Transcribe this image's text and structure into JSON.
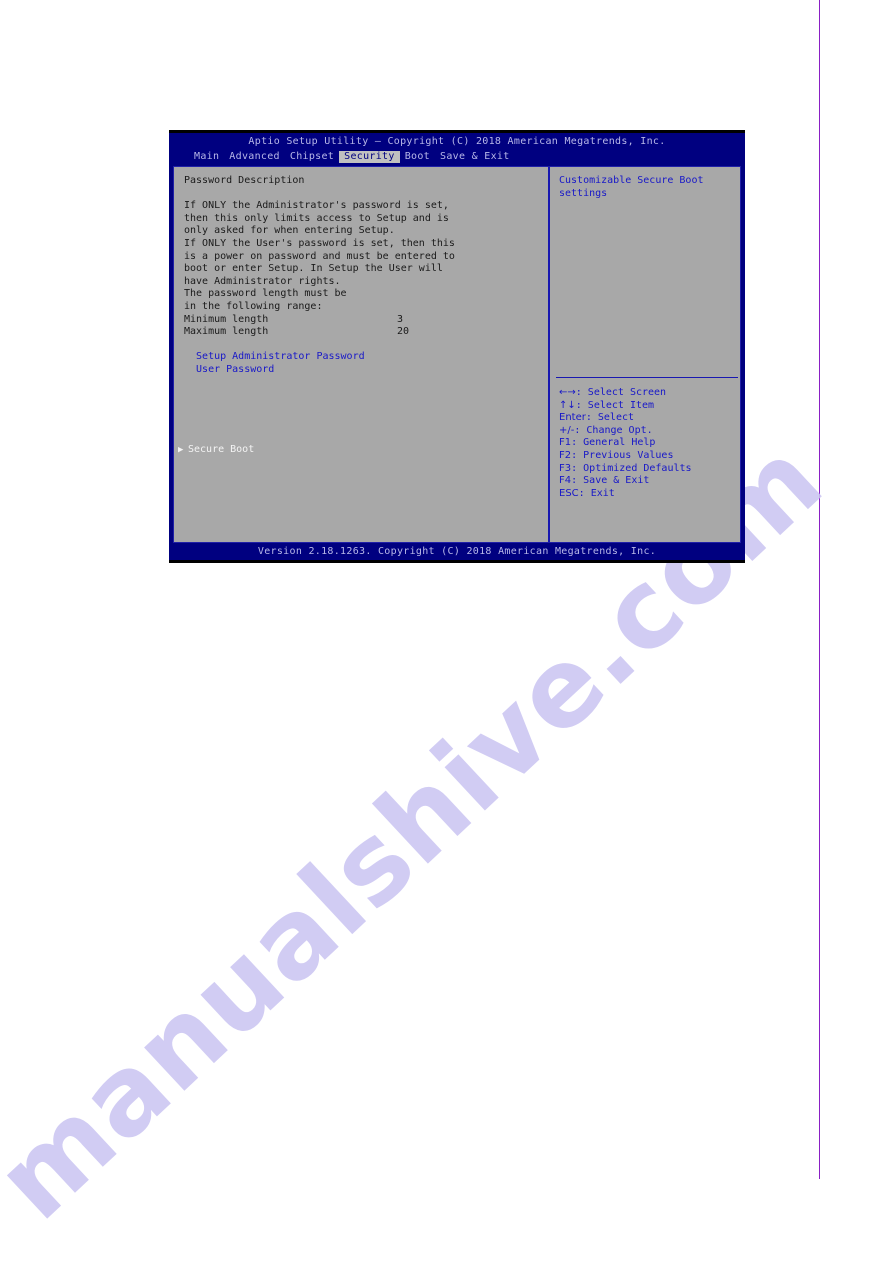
{
  "page": {
    "watermark_text": "manualshive.com",
    "margin_line_color": "#8a1fc4"
  },
  "bios": {
    "title": "Aptio Setup Utility – Copyright (C) 2018 American Megatrends, Inc.",
    "menu": [
      {
        "label": "Main",
        "active": false
      },
      {
        "label": "Advanced",
        "active": false
      },
      {
        "label": "Chipset",
        "active": false
      },
      {
        "label": "Security",
        "active": true
      },
      {
        "label": "Boot",
        "active": false
      },
      {
        "label": "Save & Exit",
        "active": false
      }
    ],
    "left_pane": {
      "section_title": "Password Description",
      "description_lines": [
        "If ONLY the Administrator's password is set,",
        "then this only limits access to Setup and is",
        "only asked for when entering Setup.",
        "If ONLY the User's password is set, then this",
        "is a power on password and must be entered to",
        "boot or enter Setup. In Setup the User will",
        "have Administrator rights.",
        "The password length must be",
        "in the following range:"
      ],
      "length_rows": [
        {
          "label": "Minimum length",
          "value": "3"
        },
        {
          "label": "Maximum length",
          "value": "20"
        }
      ],
      "options": [
        {
          "label": "Setup Administrator Password"
        },
        {
          "label": "User Password"
        }
      ],
      "submenu": {
        "label": "Secure Boot",
        "arrow_glyph": "▶",
        "selected": true
      }
    },
    "right_pane": {
      "help_lines": [
        "Customizable Secure Boot",
        "settings"
      ],
      "nav_keys": [
        {
          "key": "←→",
          "desc": ": Select Screen"
        },
        {
          "key": "↑↓",
          "desc": ": Select Item"
        },
        {
          "key": "Enter",
          "desc": ": Select"
        },
        {
          "key": "+/-",
          "desc": ": Change Opt."
        },
        {
          "key": "F1",
          "desc": ": General Help"
        },
        {
          "key": "F2",
          "desc": ": Previous Values"
        },
        {
          "key": "F3",
          "desc": ": Optimized Defaults"
        },
        {
          "key": "F4",
          "desc": ": Save & Exit"
        },
        {
          "key": "ESC",
          "desc": ": Exit"
        }
      ]
    },
    "footer": "Version 2.18.1263. Copyright (C) 2018 American Megatrends, Inc."
  }
}
